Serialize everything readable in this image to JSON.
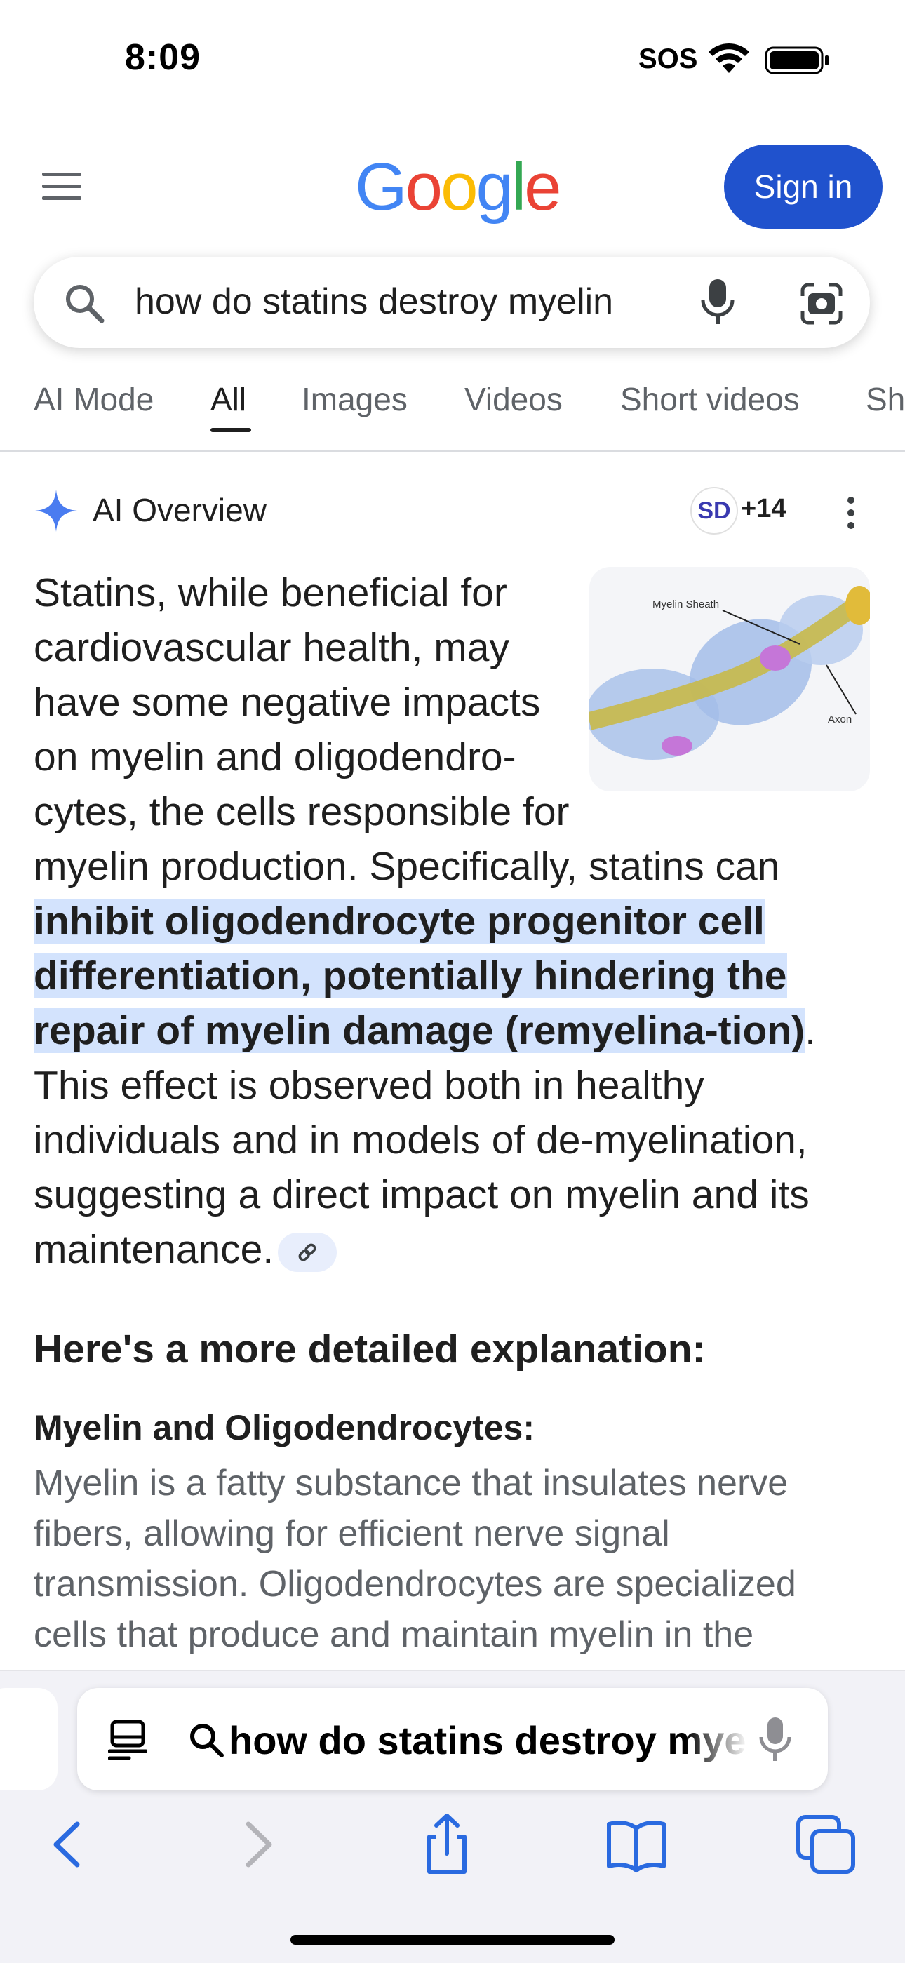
{
  "status_bar": {
    "time": "8:09",
    "carrier": "SOS"
  },
  "header": {
    "logo_letters": [
      {
        "ch": "G",
        "color": "#4285F4"
      },
      {
        "ch": "o",
        "color": "#EA4335"
      },
      {
        "ch": "o",
        "color": "#FBBC05"
      },
      {
        "ch": "g",
        "color": "#4285F4"
      },
      {
        "ch": "l",
        "color": "#34A853"
      },
      {
        "ch": "e",
        "color": "#EA4335"
      }
    ],
    "sign_in": "Sign in"
  },
  "search": {
    "query": "how do statins destroy myelin"
  },
  "tabs": [
    "AI Mode",
    "All",
    "Images",
    "Videos",
    "Short videos",
    "Sh"
  ],
  "ai_overview": {
    "title": "AI Overview",
    "source_avatar": "SD",
    "source_count": "+14",
    "thumbnail": {
      "label_top": "Myelin Sheath",
      "label_right": "Axon"
    },
    "text_before": "Statins, while beneficial for cardiovascular health, may have some negative impacts on myelin and oligodendro-cytes, the cells responsible for myelin production. Specifically, statins can ",
    "text_highlight": "inhibit oligodendrocyte progenitor cell differentiation, potentially hindering the repair of myelin damage (remyelina-tion)",
    "text_after": ". This effect is observed both in healthy individuals and in models of de-myelination, suggesting a direct impact on myelin and its maintenance."
  },
  "explanation": {
    "heading": "Here's a more detailed explanation:",
    "subheading": "Myelin and Oligodendrocytes:",
    "body": "Myelin is a fatty substance that insulates nerve fibers, allowing for efficient nerve signal transmission. Oligodendrocytes are specialized cells that produce and maintain myelin in the"
  },
  "browser": {
    "address_text": "how do statins destroy myelin"
  },
  "colors": {
    "accent": "#2052cd",
    "highlight": "#d3e3fd",
    "muted_text": "#5f6368"
  }
}
